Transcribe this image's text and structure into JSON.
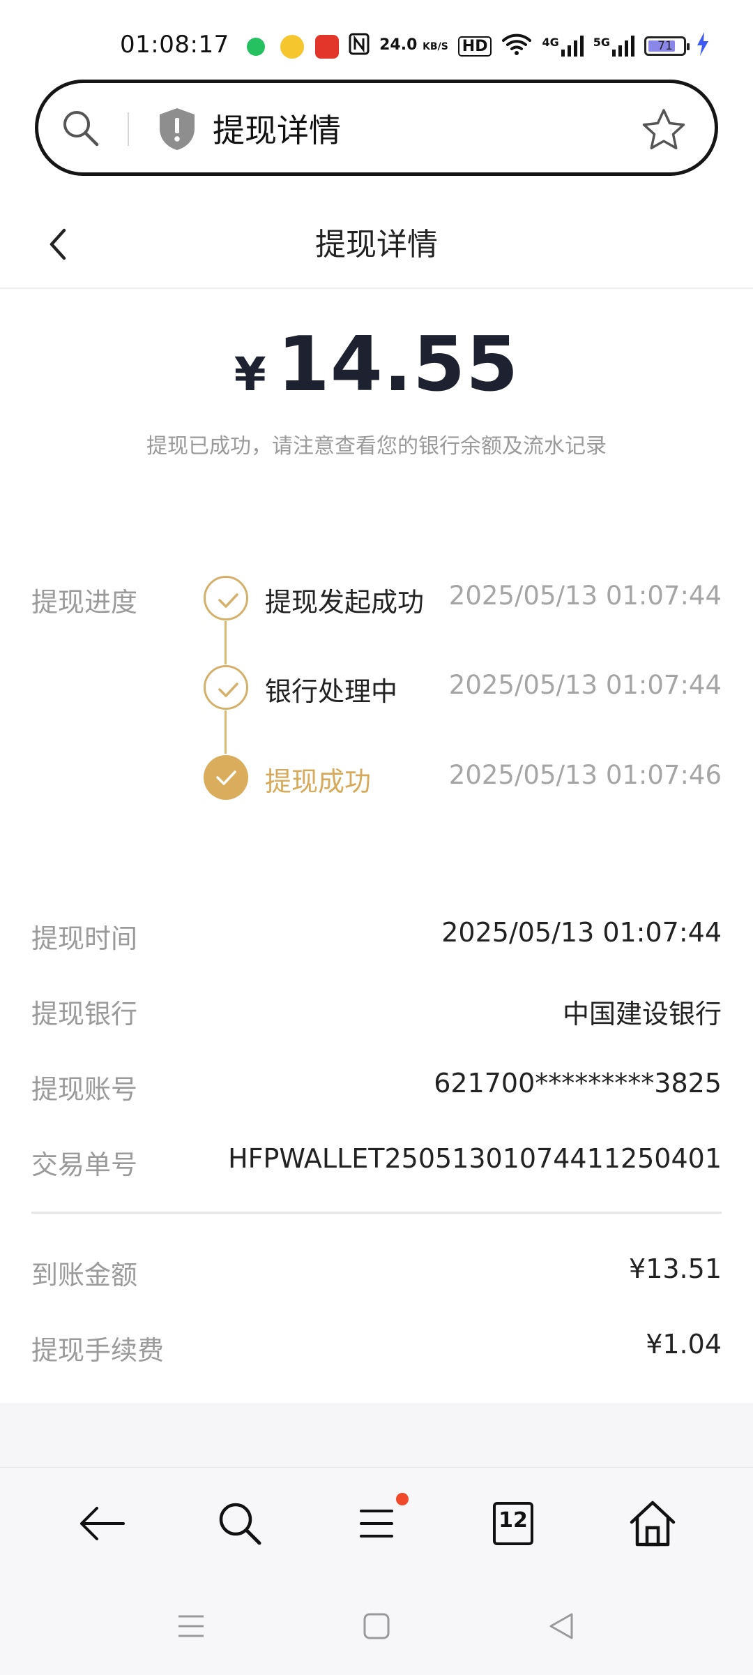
{
  "status_bar": {
    "time": "01:08:17",
    "net_speed_value": "24.0",
    "net_speed_unit": "KB/S",
    "hd_label": "HD",
    "signal_4g": "4G",
    "signal_5g": "5G",
    "battery": "71",
    "colors": {
      "battery_fill": "#8a87e8",
      "charging": "#3d5bf5"
    }
  },
  "url_bar": {
    "text": "提现详情",
    "icons": [
      "search-icon",
      "shield-alert-icon",
      "star-icon"
    ]
  },
  "header": {
    "title": "提现详情",
    "back_icon": "chevron-left-icon"
  },
  "amount": {
    "currency": "¥",
    "value": "14.55",
    "notice": "提现已成功，请注意查看您的银行余额及流水记录"
  },
  "progress": {
    "label": "提现进度",
    "steps": [
      {
        "text": "提现发起成功",
        "time": "2025/05/13 01:07:44",
        "state": "done"
      },
      {
        "text": "银行处理中",
        "time": "2025/05/13 01:07:44",
        "state": "done"
      },
      {
        "text": "提现成功",
        "time": "2025/05/13 01:07:46",
        "state": "current"
      }
    ],
    "accent_color": "#d9ad5b"
  },
  "details": [
    {
      "label": "提现时间",
      "value": "2025/05/13 01:07:44"
    },
    {
      "label": "提现银行",
      "value": "中国建设银行"
    },
    {
      "label": "提现账号",
      "value": "621700*********3825"
    },
    {
      "label": "交易单号",
      "value": "HFPWALLET25051301074411250401"
    }
  ],
  "fees": [
    {
      "label": "到账金额",
      "value": "¥13.51"
    },
    {
      "label": "提现手续费",
      "value": "¥1.04"
    }
  ],
  "toolbar": {
    "tab_count": "12",
    "icons": [
      "arrow-left-icon",
      "search-icon",
      "menu-icon",
      "tabs-icon",
      "home-icon"
    ]
  },
  "nav_bar": {
    "icons": [
      "recent-apps-icon",
      "home-square-icon",
      "back-triangle-icon"
    ]
  }
}
